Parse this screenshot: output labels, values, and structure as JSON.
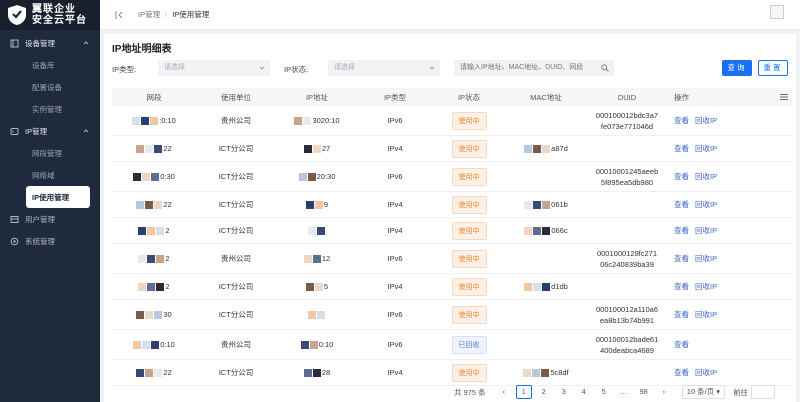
{
  "app": {
    "logo_line1": "翼联企业",
    "logo_line2": "安全云平台"
  },
  "sidebar": {
    "groups": [
      {
        "label": "设备管理",
        "icon": "device-icon",
        "children": [
          "设备库",
          "配置设备",
          "实例管理"
        ]
      },
      {
        "label": "IP管理",
        "icon": "ip-icon",
        "children": [
          "网段管理",
          "网络域",
          "IP使用管理"
        ]
      },
      {
        "label": "用户管理",
        "icon": "user-icon",
        "children": []
      },
      {
        "label": "系统管理",
        "icon": "system-icon",
        "children": []
      }
    ],
    "active_item": "IP使用管理"
  },
  "breadcrumb": {
    "parent": "IP管理",
    "current": "IP使用管理"
  },
  "page": {
    "title": "IP地址明细表"
  },
  "filters": {
    "ip_type_label": "IP类型:",
    "ip_type_placeholder": "请选择",
    "ip_status_label": "IP状态:",
    "ip_status_placeholder": "请选择",
    "search_placeholder": "请输入IP地址、MAC地址、DUID、网段",
    "query_label": "查询",
    "reset_label": "重置"
  },
  "table": {
    "columns": [
      "网段",
      "使用单位",
      "IP地址",
      "IP类型",
      "IP状态",
      "MAC地址",
      "DUID",
      "操作"
    ],
    "rows": [
      {
        "segment": ":0:10",
        "unit": "贵州公司",
        "ip": "3020:10",
        "type": "IPv6",
        "status": "使用中",
        "mac": "",
        "duid": [
          "000100012bdc3a7",
          "fe073e771046d"
        ],
        "ops": [
          "查看",
          "回收IP"
        ]
      },
      {
        "segment": "22",
        "unit": "ICT分公司",
        "ip": "27",
        "type": "IPv4",
        "status": "使用中",
        "mac": "a87d",
        "duid": [],
        "ops": [
          "查看",
          "回收IP"
        ]
      },
      {
        "segment": "0:30",
        "unit": "ICT分公司",
        "ip": "20:30",
        "type": "IPv6",
        "status": "使用中",
        "mac": "",
        "duid": [
          "00010001245aeeb",
          "5f895ea5db980"
        ],
        "ops": [
          "查看",
          "回收IP"
        ]
      },
      {
        "segment": "22",
        "unit": "ICT分公司",
        "ip": "9",
        "type": "IPv4",
        "status": "使用中",
        "mac": "061b",
        "duid": [],
        "ops": [
          "查看",
          "回收IP"
        ]
      },
      {
        "segment": "2",
        "unit": "ICT分公司",
        "ip": "",
        "type": "IPv4",
        "status": "使用中",
        "mac": "066c",
        "duid": [],
        "ops": [
          "查看",
          "回收IP"
        ]
      },
      {
        "segment": "2",
        "unit": "贵州公司",
        "ip": "12",
        "type": "IPv6",
        "status": "使用中",
        "mac": "",
        "duid": [
          "0001000129fc271",
          "06c240839ba39"
        ],
        "ops": [
          "查看",
          "回收IP"
        ]
      },
      {
        "segment": "2",
        "unit": "ICT分公司",
        "ip": "5",
        "type": "IPv4",
        "status": "使用中",
        "mac": "d1db",
        "duid": [],
        "ops": [
          "查看",
          "回收IP"
        ]
      },
      {
        "segment": "30",
        "unit": "ICT分公司",
        "ip": "",
        "type": "IPv6",
        "status": "使用中",
        "mac": "",
        "duid": [
          "000100012a110a6",
          "ea8b13b74b991"
        ],
        "ops": [
          "查看",
          "回收IP"
        ]
      },
      {
        "segment": "0:10",
        "unit": "贵州公司",
        "ip": "0:10",
        "type": "IPv6",
        "status": "已回收",
        "mac": "",
        "duid": [
          "000100012bade61",
          "400deabca4689"
        ],
        "ops": [
          "查看"
        ]
      },
      {
        "segment": "22",
        "unit": "ICT分公司",
        "ip": "28",
        "type": "IPv4",
        "status": "使用中",
        "mac": "5c8df",
        "duid": [],
        "ops": [
          "查看",
          "回收IP"
        ]
      }
    ]
  },
  "pagination": {
    "total_text": "共 975 条",
    "pages": [
      "1",
      "2",
      "3",
      "4",
      "5",
      "...",
      "98"
    ],
    "current": "1",
    "page_size": "10 条/页",
    "jump_label": "前往"
  },
  "colors": {
    "sidebar_bg": "#1f2a3c",
    "primary": "#1a6ff5",
    "in_use": "#e8862a",
    "recycled": "#5b7fd6"
  }
}
